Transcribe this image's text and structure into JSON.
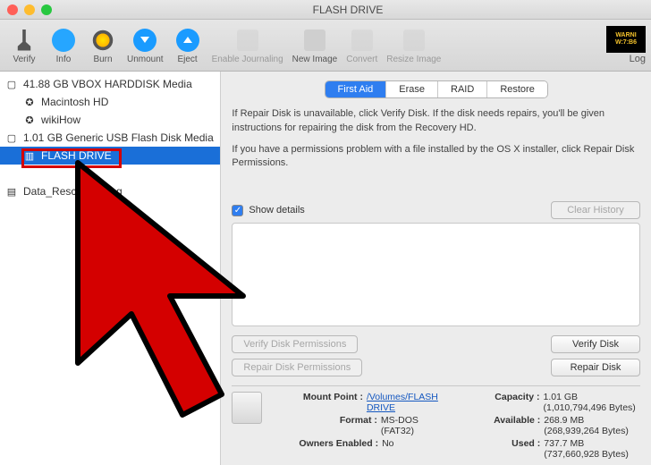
{
  "window": {
    "title": "FLASH DRIVE"
  },
  "toolbar": {
    "items": [
      {
        "label": "Verify",
        "icon": "microscope",
        "enabled": true
      },
      {
        "label": "Info",
        "icon": "info",
        "enabled": true
      },
      {
        "label": "Burn",
        "icon": "burn",
        "enabled": true
      },
      {
        "label": "Unmount",
        "icon": "arrow-down",
        "enabled": true
      },
      {
        "label": "Eject",
        "icon": "arrow-up",
        "enabled": true
      },
      {
        "label": "Enable Journaling",
        "icon": "grey",
        "enabled": false
      },
      {
        "label": "New Image",
        "icon": "grey",
        "enabled": true
      },
      {
        "label": "Convert",
        "icon": "grey",
        "enabled": false
      },
      {
        "label": "Resize Image",
        "icon": "grey",
        "enabled": false
      }
    ],
    "log": "Log",
    "warn1": "WARNI",
    "warn2": "W:7:B6"
  },
  "sidebar": {
    "items": [
      {
        "label": "41.88 GB VBOX HARDDISK Media",
        "icon": "hdd",
        "indent": false,
        "sel": false
      },
      {
        "label": "Macintosh HD",
        "icon": "mac",
        "indent": true,
        "sel": false
      },
      {
        "label": "wikiHow",
        "icon": "mac",
        "indent": true,
        "sel": false
      },
      {
        "label": "1.01 GB Generic USB Flash Disk Media",
        "icon": "hdd",
        "indent": false,
        "sel": false
      },
      {
        "label": "FLASH DRIVE",
        "icon": "usb",
        "indent": true,
        "sel": true
      },
      {
        "label": "",
        "icon": "",
        "indent": false,
        "sel": false
      },
      {
        "label": "Data_Rescue           S.dmg",
        "icon": "dmg",
        "indent": false,
        "sel": false
      }
    ]
  },
  "tabs": [
    "First Aid",
    "Erase",
    "RAID",
    "Restore"
  ],
  "active_tab": 0,
  "info": {
    "p1": "If Repair Disk is unavailable, click Verify Disk. If the disk needs repairs, you'll be given instructions for repairing the disk from the Recovery HD.",
    "p2": "If you have a permissions problem with a file installed by the OS X installer, click Repair Disk Permissions."
  },
  "show_details": "Show details",
  "clear_history": "Clear History",
  "buttons": {
    "verify_perm": "Verify Disk Permissions",
    "repair_perm": "Repair Disk Permissions",
    "verify_disk": "Verify Disk",
    "repair_disk": "Repair Disk"
  },
  "footer": {
    "mount_k": "Mount Point :",
    "mount_v": "/Volumes/FLASH DRIVE",
    "format_k": "Format :",
    "format_v": "MS-DOS (FAT32)",
    "owners_k": "Owners Enabled :",
    "owners_v": "No",
    "cap_k": "Capacity :",
    "cap_v": "1.01 GB (1,010,794,496 Bytes)",
    "avail_k": "Available :",
    "avail_v": "268.9 MB (268,939,264 Bytes)",
    "used_k": "Used :",
    "used_v": "737.7 MB (737,660,928 Bytes)"
  }
}
